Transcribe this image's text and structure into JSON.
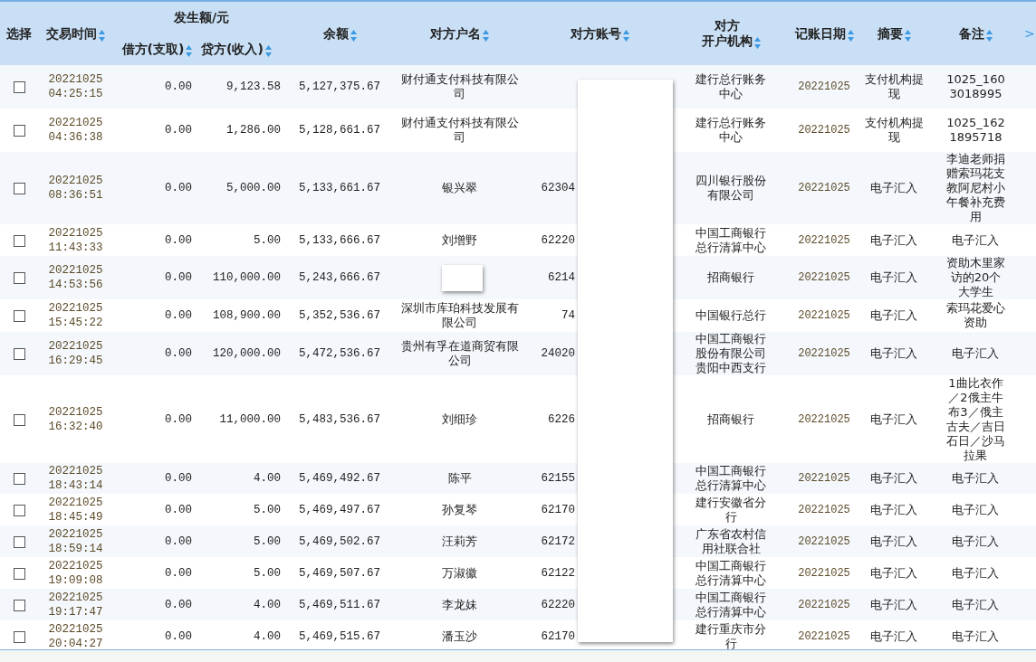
{
  "table": {
    "columns": [
      {
        "kind": "select",
        "label": "选择"
      },
      {
        "kind": "time",
        "label": "交易时间",
        "sortable": true
      },
      {
        "kind": "group",
        "label": "发生额/元",
        "children": [
          {
            "label": "借方(支取)",
            "sortable": true
          },
          {
            "label": "贷方(收入)",
            "sortable": true
          }
        ]
      },
      {
        "kind": "balance",
        "label": "余额",
        "sortable": true
      },
      {
        "kind": "name",
        "label": "对方户名",
        "sortable": true
      },
      {
        "kind": "account",
        "label": "对方账号",
        "sortable": true
      },
      {
        "kind": "bank",
        "label_lines": [
          "对方",
          "开户机构"
        ],
        "sortable": true
      },
      {
        "kind": "date",
        "label": "记账日期",
        "sortable": true
      },
      {
        "kind": "summary",
        "label": "摘要",
        "sortable": true
      },
      {
        "kind": "remark",
        "label": "备注",
        "sortable": true
      }
    ],
    "more_columns": ">",
    "rows": [
      {
        "checked": false,
        "date": "20221025",
        "time": "04:25:15",
        "debit": "0.00",
        "credit": "9,123.58",
        "balance": "5,127,375.67",
        "name": "财付通支付科技有限公司",
        "bank": "建行总行账务中心",
        "post_date": "20221025",
        "summary": "支付机构提现",
        "remark": "1025_1603018995"
      },
      {
        "checked": false,
        "date": "20221025",
        "time": "04:36:38",
        "debit": "0.00",
        "credit": "1,286.00",
        "balance": "5,128,661.67",
        "name": "财付通支付科技有限公司",
        "bank": "建行总行账务中心",
        "post_date": "20221025",
        "summary": "支付机构提现",
        "remark": "1025_1621895718"
      },
      {
        "checked": false,
        "date": "20221025",
        "time": "08:36:51",
        "debit": "0.00",
        "credit": "5,000.00",
        "balance": "5,133,661.67",
        "name": "银兴翠",
        "account": "62304",
        "bank": "四川银行股份有限公司",
        "post_date": "20221025",
        "summary": "电子汇入",
        "remark": "李迪老师捐赠索玛花支教阿尼村小午餐补充费用"
      },
      {
        "checked": false,
        "date": "20221025",
        "time": "11:43:33",
        "debit": "0.00",
        "credit": "5.00",
        "balance": "5,133,666.67",
        "name": "刘增野",
        "account": "62220",
        "bank": "中国工商银行总行清算中心",
        "post_date": "20221025",
        "summary": "电子汇入",
        "remark": "电子汇入"
      },
      {
        "checked": false,
        "date": "20221025",
        "time": "14:53:56",
        "debit": "0.00",
        "credit": "110,000.00",
        "balance": "5,243,666.67",
        "account": "6214",
        "bank": "招商银行",
        "post_date": "20221025",
        "summary": "电子汇入",
        "remark": "资助木里家访的20个大学生"
      },
      {
        "checked": false,
        "date": "20221025",
        "time": "15:45:22",
        "debit": "0.00",
        "credit": "108,900.00",
        "balance": "5,352,536.67",
        "name": "深圳市库珀科技发展有限公司",
        "account": "74",
        "bank": "中国银行总行",
        "post_date": "20221025",
        "summary": "电子汇入",
        "remark": "索玛花爱心资助"
      },
      {
        "checked": false,
        "date": "20221025",
        "time": "16:29:45",
        "debit": "0.00",
        "credit": "120,000.00",
        "balance": "5,472,536.67",
        "name": "贵州有孚在道商贸有限公司",
        "account": "24020",
        "bank": "中国工商银行股份有限公司贵阳中西支行",
        "post_date": "20221025",
        "summary": "电子汇入",
        "remark": "电子汇入"
      },
      {
        "checked": false,
        "date": "20221025",
        "time": "16:32:40",
        "debit": "0.00",
        "credit": "11,000.00",
        "balance": "5,483,536.67",
        "name": "刘细珍",
        "account": "6226",
        "bank": "招商银行",
        "post_date": "20221025",
        "summary": "电子汇入",
        "remark": "1曲比衣作／2俄主牛布3／俄主古夫／吉日石日／沙马拉果"
      },
      {
        "checked": false,
        "date": "20221025",
        "time": "18:43:14",
        "debit": "0.00",
        "credit": "4.00",
        "balance": "5,469,492.67",
        "name": "陈平",
        "account": "62155",
        "bank": "中国工商银行总行清算中心",
        "post_date": "20221025",
        "summary": "电子汇入",
        "remark": "电子汇入"
      },
      {
        "checked": false,
        "date": "20221025",
        "time": "18:45:49",
        "debit": "0.00",
        "credit": "5.00",
        "balance": "5,469,497.67",
        "name": "孙复琴",
        "account": "62170",
        "bank": "建行安徽省分行",
        "post_date": "20221025",
        "summary": "电子汇入",
        "remark": "电子汇入"
      },
      {
        "checked": false,
        "date": "20221025",
        "time": "18:59:14",
        "debit": "0.00",
        "credit": "5.00",
        "balance": "5,469,502.67",
        "name": "汪莉芳",
        "account": "62172",
        "bank": "广东省农村信用社联合社",
        "post_date": "20221025",
        "summary": "电子汇入",
        "remark": "电子汇入"
      },
      {
        "checked": false,
        "date": "20221025",
        "time": "19:09:08",
        "debit": "0.00",
        "credit": "5.00",
        "balance": "5,469,507.67",
        "name": "万淑徽",
        "account": "62122",
        "bank": "中国工商银行总行清算中心",
        "post_date": "20221025",
        "summary": "电子汇入",
        "remark": "电子汇入"
      },
      {
        "checked": false,
        "date": "20221025",
        "time": "19:17:47",
        "debit": "0.00",
        "credit": "4.00",
        "balance": "5,469,511.67",
        "name": "李龙妹",
        "account": "62220",
        "bank": "中国工商银行总行清算中心",
        "post_date": "20221025",
        "summary": "电子汇入",
        "remark": "电子汇入"
      },
      {
        "checked": false,
        "date": "20221025",
        "time": "20:04:27",
        "debit": "0.00",
        "credit": "4.00",
        "balance": "5,469,515.67",
        "name": "潘玉沙",
        "account": "62170",
        "bank": "建行重庆市分行",
        "post_date": "20221025",
        "summary": "电子汇入",
        "remark": "电子汇入"
      }
    ]
  }
}
